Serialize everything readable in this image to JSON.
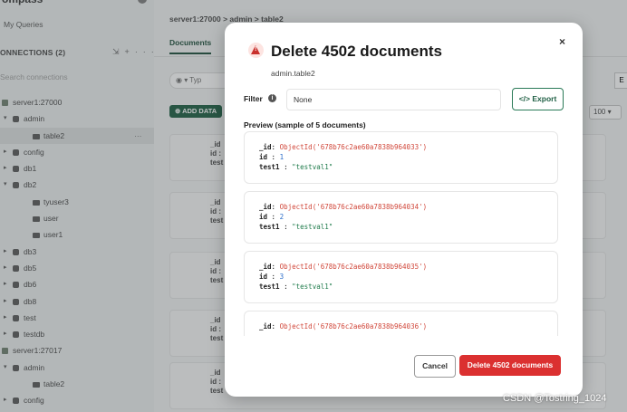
{
  "sidebar": {
    "app_title": "ompass",
    "my_queries": "My Queries",
    "connections_label": "ONNECTIONS",
    "connections_count": "(2)",
    "search_placeholder": "Search connections",
    "tree": [
      {
        "label": "server1:27000",
        "level": 0,
        "kind": "server"
      },
      {
        "label": "admin",
        "level": 1,
        "kind": "db",
        "caret": "▾"
      },
      {
        "label": "table2",
        "level": 2,
        "kind": "collection",
        "active": true
      },
      {
        "label": "config",
        "level": 1,
        "kind": "db",
        "caret": "▸"
      },
      {
        "label": "db1",
        "level": 1,
        "kind": "db",
        "caret": "▸"
      },
      {
        "label": "db2",
        "level": 1,
        "kind": "db",
        "caret": "▾"
      },
      {
        "label": "tyuser3",
        "level": 2,
        "kind": "collection"
      },
      {
        "label": "user",
        "level": 2,
        "kind": "collection"
      },
      {
        "label": "user1",
        "level": 2,
        "kind": "collection"
      },
      {
        "label": "db3",
        "level": 1,
        "kind": "db",
        "caret": "▸"
      },
      {
        "label": "db5",
        "level": 1,
        "kind": "db",
        "caret": "▸"
      },
      {
        "label": "db6",
        "level": 1,
        "kind": "db",
        "caret": "▸"
      },
      {
        "label": "db8",
        "level": 1,
        "kind": "db",
        "caret": "▸"
      },
      {
        "label": "test",
        "level": 1,
        "kind": "db",
        "caret": "▸"
      },
      {
        "label": "testdb",
        "level": 1,
        "kind": "db",
        "caret": "▸"
      },
      {
        "label": "server1:27017",
        "level": 0,
        "kind": "server"
      },
      {
        "label": "admin",
        "level": 1,
        "kind": "db",
        "caret": "▾"
      },
      {
        "label": "table2",
        "level": 2,
        "kind": "collection"
      },
      {
        "label": "config",
        "level": 1,
        "kind": "db",
        "caret": "▸"
      }
    ],
    "row_menu": "···"
  },
  "main": {
    "breadcrumb": "server1:27000 > admin > table2",
    "tab_documents": "Documents",
    "add_data": "ADD DATA",
    "per_page": "100 ▾",
    "filter_partial": "Typ",
    "right_btn": "E",
    "bg_lines": [
      "_id",
      "id :",
      "test"
    ]
  },
  "modal": {
    "title": "Delete 4502 documents",
    "namespace": "admin.table2",
    "filter_label": "Filter",
    "filter_value": "None",
    "export_label": "Export",
    "preview_label": "Preview (sample of 5 documents)",
    "docs": [
      {
        "oid": "ObjectId('678b76c2ae60a7838b964033')",
        "id": "1",
        "test1": "\"testval1\""
      },
      {
        "oid": "ObjectId('678b76c2ae60a7838b964034')",
        "id": "2",
        "test1": "\"testval1\""
      },
      {
        "oid": "ObjectId('678b76c2ae60a7838b964035')",
        "id": "3",
        "test1": "\"testval1\""
      },
      {
        "oid": "ObjectId('678b76c2ae60a7838b964036')",
        "id": "",
        "test1": ""
      }
    ],
    "key_id": "_id",
    "key_idf": "id",
    "key_test1": "test1",
    "cancel_label": "Cancel",
    "delete_label": "Delete 4502 documents",
    "close_icon": "×"
  },
  "watermark": "CSDN @Tostring_1024",
  "colors": {
    "danger": "#db3030",
    "accent": "#2a7a57"
  }
}
